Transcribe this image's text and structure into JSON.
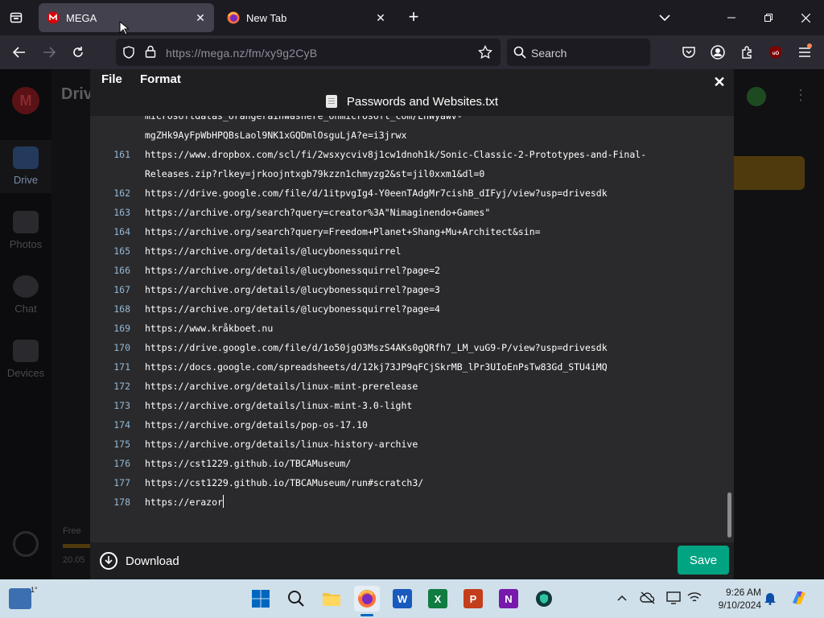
{
  "browser": {
    "tabs": [
      {
        "title": "MEGA",
        "active": true,
        "favicon": "mega-logo-icon"
      },
      {
        "title": "New Tab",
        "active": false,
        "favicon": "firefox-icon"
      }
    ],
    "url": "https://mega.nz/fm/xy9g2CyB",
    "search_placeholder": "Search"
  },
  "mega": {
    "header_title": "Drive",
    "sidebar": [
      {
        "label": "Drive",
        "icon": "folder-icon",
        "active": true
      },
      {
        "label": "Photos",
        "icon": "photo-icon",
        "active": false
      },
      {
        "label": "Chat",
        "icon": "chat-icon",
        "active": false
      },
      {
        "label": "Devices",
        "icon": "devices-icon",
        "active": false
      }
    ],
    "storage_label": "Free",
    "storage_size": "20.05"
  },
  "editor": {
    "menu": [
      "File",
      "Format"
    ],
    "filename": "Passwords and Websites.txt",
    "lines": [
      {
        "num": "",
        "text": "microsoftdatas_orangerainwashere_onmicrosoft_com/EnWyawv-"
      },
      {
        "num": "",
        "text": "mgZHk9AyFpWbHPQBsLaol9NK1xGQDmlOsguLjA?e=i3jrwx"
      },
      {
        "num": "161",
        "text": "https://www.dropbox.com/scl/fi/2wsxycviv8j1cw1dnoh1k/Sonic-Classic-2-Prototypes-and-Final-"
      },
      {
        "num": "",
        "text": "Releases.zip?rlkey=jrkoojntxgb79kzzn1chmyzg2&st=jil0xxm1&dl=0"
      },
      {
        "num": "162",
        "text": "https://drive.google.com/file/d/1itpvgIg4-Y0eenTAdgMr7cishB_dIFyj/view?usp=drivesdk"
      },
      {
        "num": "163",
        "text": "https://archive.org/search?query=creator%3A\"Nimaginendo+Games\""
      },
      {
        "num": "164",
        "text": "https://archive.org/search?query=Freedom+Planet+Shang+Mu+Architect&sin="
      },
      {
        "num": "165",
        "text": "https://archive.org/details/@lucybonessquirrel"
      },
      {
        "num": "166",
        "text": "https://archive.org/details/@lucybonessquirrel?page=2"
      },
      {
        "num": "167",
        "text": "https://archive.org/details/@lucybonessquirrel?page=3"
      },
      {
        "num": "168",
        "text": "https://archive.org/details/@lucybonessquirrel?page=4"
      },
      {
        "num": "169",
        "text": "https://www.kråkboet.nu"
      },
      {
        "num": "170",
        "text": "https://drive.google.com/file/d/1o50jgO3MszS4AKs0gQRfh7_LM_vuG9-P/view?usp=drivesdk"
      },
      {
        "num": "171",
        "text": "https://docs.google.com/spreadsheets/d/12kj73JP9qFCjSkrMB_lPr3UIoEnPsTw83Gd_STU4iMQ"
      },
      {
        "num": "172",
        "text": "https://archive.org/details/linux-mint-prerelease"
      },
      {
        "num": "173",
        "text": "https://archive.org/details/linux-mint-3.0-light"
      },
      {
        "num": "174",
        "text": "https://archive.org/details/pop-os-17.10"
      },
      {
        "num": "175",
        "text": "https://archive.org/details/linux-history-archive"
      },
      {
        "num": "176",
        "text": "https://cst1229.github.io/TBCAMuseum/"
      },
      {
        "num": "177",
        "text": "https://cst1229.github.io/TBCAMuseum/run#scratch3/"
      },
      {
        "num": "178",
        "text": "https://erazor"
      }
    ],
    "download_label": "Download",
    "save_label": "Save"
  },
  "taskbar": {
    "weather_temp": "1°",
    "time": "9:26 AM",
    "date": "9/10/2024",
    "apps": [
      "start-icon",
      "search-icon",
      "file-explorer-icon",
      "firefox-icon",
      "word-icon",
      "excel-icon",
      "powerpoint-icon",
      "onenote-icon",
      "vpn-shield-icon"
    ]
  },
  "colors": {
    "accent_save": "#00a382",
    "mega_red": "#d90007",
    "line_number": "#93b8d6"
  }
}
